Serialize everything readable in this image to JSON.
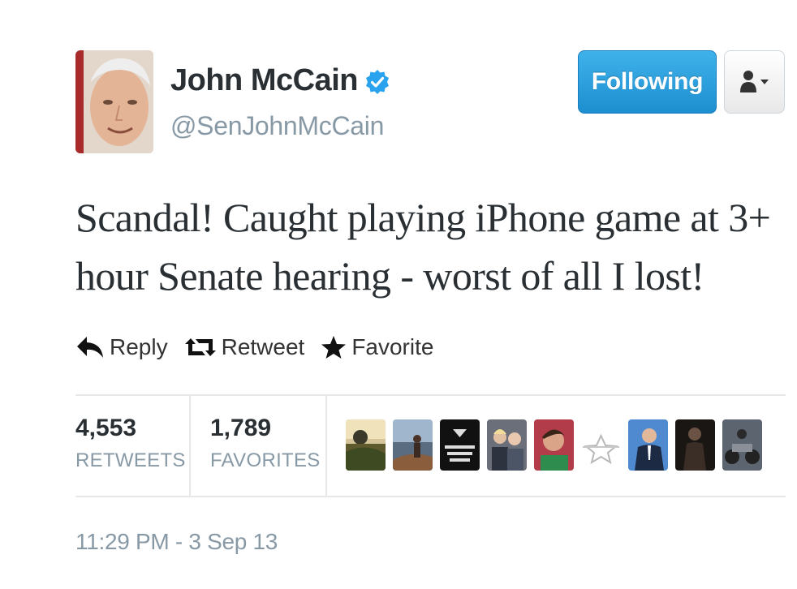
{
  "author": {
    "name": "John McCain",
    "handle": "@SenJohnMcCain",
    "verified_icon": "verified-badge-icon",
    "avatar_icon": "profile-photo"
  },
  "header": {
    "follow_button_label": "Following",
    "user_menu_icon": "user-dropdown-icon"
  },
  "tweet": {
    "text": "Scandal! Caught playing iPhone game at 3+ hour Senate hearing - worst of all I lost!"
  },
  "actions": {
    "reply_label": "Reply",
    "retweet_label": "Retweet",
    "favorite_label": "Favorite"
  },
  "stats": {
    "retweets_count": "4,553",
    "retweets_label": "RETWEETS",
    "favorites_count": "1,789",
    "favorites_label": "FAVORITES"
  },
  "favoriter_avatars": [
    "avatar-photo-sunset",
    "avatar-photo-coast",
    "avatar-photo-band-logo",
    "avatar-photo-group",
    "avatar-photo-selfie",
    "avatar-default-egg",
    "avatar-photo-suit",
    "avatar-photo-dark-figure",
    "avatar-photo-motorcycle"
  ],
  "timestamp": "11:29 PM - 3 Sep 13",
  "colors": {
    "follow_button": "#1d8fd0",
    "verified": "#2aa3ef",
    "muted_text": "#8899a6",
    "text": "#292f33",
    "divider": "#e8e8e8"
  }
}
